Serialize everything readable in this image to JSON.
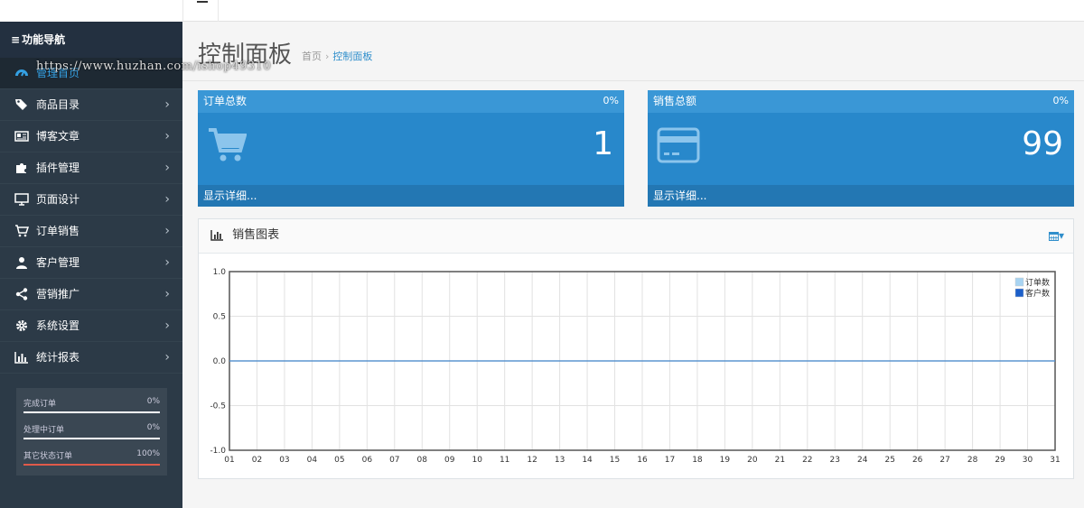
{
  "header": {
    "toggle_icon": "hamburger-icon"
  },
  "watermark": "https://www.huzhan.com/ishop49310",
  "sidebar": {
    "title": "功能导航",
    "items": [
      {
        "label": "管理首页",
        "icon": "dashboard-icon",
        "active": true
      },
      {
        "label": "商品目录",
        "icon": "tags-icon"
      },
      {
        "label": "博客文章",
        "icon": "newspaper-icon"
      },
      {
        "label": "插件管理",
        "icon": "puzzle-icon"
      },
      {
        "label": "页面设计",
        "icon": "monitor-icon"
      },
      {
        "label": "订单销售",
        "icon": "cart-icon"
      },
      {
        "label": "客户管理",
        "icon": "user-icon"
      },
      {
        "label": "营销推广",
        "icon": "share-icon"
      },
      {
        "label": "系统设置",
        "icon": "gear-icon"
      },
      {
        "label": "统计报表",
        "icon": "bar-chart-icon"
      }
    ],
    "chevron": "›",
    "stats": [
      {
        "label": "完成订单",
        "value": "0%",
        "fraction": 0
      },
      {
        "label": "处理中订单",
        "value": "0%",
        "fraction": 0
      },
      {
        "label": "其它状态订单",
        "value": "100%",
        "fraction": 1
      }
    ]
  },
  "page": {
    "title": "控制面板",
    "breadcrumb": {
      "home": "首页",
      "sep": "›",
      "current": "控制面板"
    }
  },
  "tiles": [
    {
      "title": "订单总数",
      "percent": "0%",
      "value": "1",
      "footer": "显示详细...",
      "icon": "cart-icon"
    },
    {
      "title": "销售总额",
      "percent": "0%",
      "value": "99",
      "footer": "显示详细...",
      "icon": "credit-card-icon"
    }
  ],
  "chart_panel": {
    "title": "销售图表",
    "icon": "bar-chart-icon",
    "calendar_icon": "calendar-icon",
    "caret": "▾"
  },
  "colors": {
    "accent": "#2f8ecb",
    "tile": "#2888cb",
    "sidebar": "#2c3a47",
    "series1": "#a8d4f2",
    "series2": "#1c5fc9"
  },
  "chart_data": {
    "type": "line",
    "x": [
      "01",
      "02",
      "03",
      "04",
      "05",
      "06",
      "07",
      "08",
      "09",
      "10",
      "11",
      "12",
      "13",
      "14",
      "15",
      "16",
      "17",
      "18",
      "19",
      "20",
      "21",
      "22",
      "23",
      "24",
      "25",
      "26",
      "27",
      "28",
      "29",
      "30",
      "31"
    ],
    "series": [
      {
        "name": "订单数",
        "values": [
          0,
          0,
          0,
          0,
          0,
          0,
          0,
          0,
          0,
          0,
          0,
          0,
          0,
          0,
          0,
          0,
          0,
          0,
          0,
          0,
          0,
          0,
          0,
          0,
          0,
          0,
          0,
          0,
          0,
          0,
          0
        ]
      },
      {
        "name": "客户数",
        "values": [
          0,
          0,
          0,
          0,
          0,
          0,
          0,
          0,
          0,
          0,
          0,
          0,
          0,
          0,
          0,
          0,
          0,
          0,
          0,
          0,
          0,
          0,
          0,
          0,
          0,
          0,
          0,
          0,
          0,
          0,
          0
        ]
      }
    ],
    "y_ticks": [
      "1.0",
      "0.5",
      "0.0",
      "-0.5",
      "-1.0"
    ],
    "ylim": [
      -1,
      1
    ],
    "grid": true,
    "legend": "top-right"
  }
}
